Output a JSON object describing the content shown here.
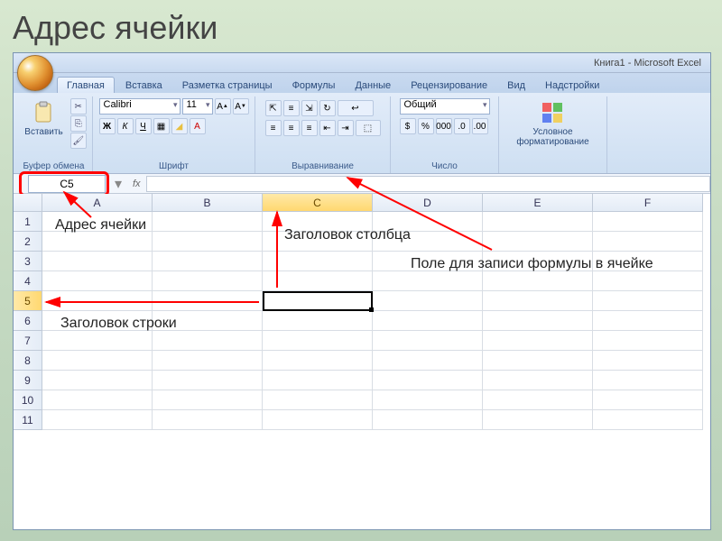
{
  "slide": {
    "title": "Адрес ячейки"
  },
  "window": {
    "title": "Книга1 - Microsoft Excel"
  },
  "tabs": {
    "home": "Главная",
    "insert": "Вставка",
    "page_layout": "Разметка страницы",
    "formulas": "Формулы",
    "data": "Данные",
    "review": "Рецензирование",
    "view": "Вид",
    "addins": "Надстройки"
  },
  "ribbon": {
    "clipboard": {
      "label": "Буфер обмена",
      "paste": "Вставить"
    },
    "font": {
      "label": "Шрифт",
      "name": "Calibri",
      "size": "11",
      "bold": "Ж",
      "italic": "К",
      "under": "Ч"
    },
    "alignment": {
      "label": "Выравнивание"
    },
    "number": {
      "label": "Число",
      "format": "Общий"
    },
    "styles": {
      "label": "",
      "cond_fmt": "Условное\nформатирование"
    }
  },
  "name_box": {
    "value": "C5"
  },
  "fx_label": "fx",
  "columns": [
    "A",
    "B",
    "C",
    "D",
    "E",
    "F"
  ],
  "rows": [
    "1",
    "2",
    "3",
    "4",
    "5",
    "6",
    "7",
    "8",
    "9",
    "10",
    "11"
  ],
  "active": {
    "col": "C",
    "row": "5"
  },
  "annotations": {
    "addr": "Адрес ячейки",
    "col_header": "Заголовок столбца",
    "row_header": "Заголовок строки",
    "formula_field": "Поле для записи формулы в ячейке"
  }
}
